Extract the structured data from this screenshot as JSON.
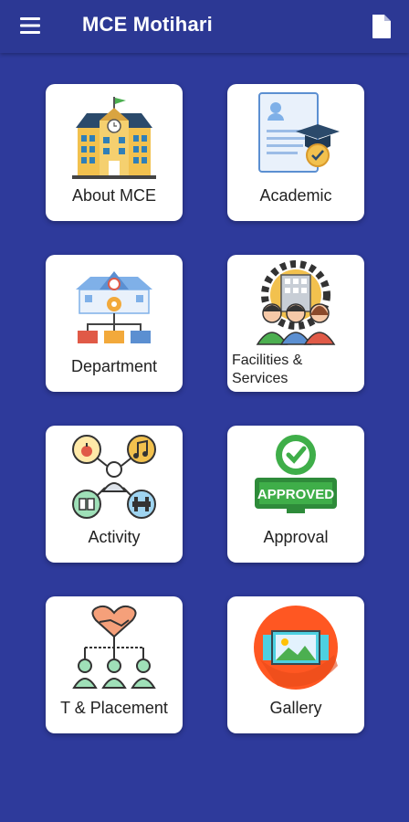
{
  "appbar": {
    "title": "MCE Motihari"
  },
  "tiles": [
    {
      "label": "About MCE"
    },
    {
      "label": "Academic"
    },
    {
      "label": "Department"
    },
    {
      "label": "Facilities &\nServices"
    },
    {
      "label": "Activity"
    },
    {
      "label": "Approval",
      "badge_text": "APPROVED"
    },
    {
      "label": "T & Placement"
    },
    {
      "label": "Gallery"
    }
  ],
  "colors": {
    "background": "#2e3a9b",
    "appbar": "#2c3894",
    "tile": "#ffffff"
  }
}
